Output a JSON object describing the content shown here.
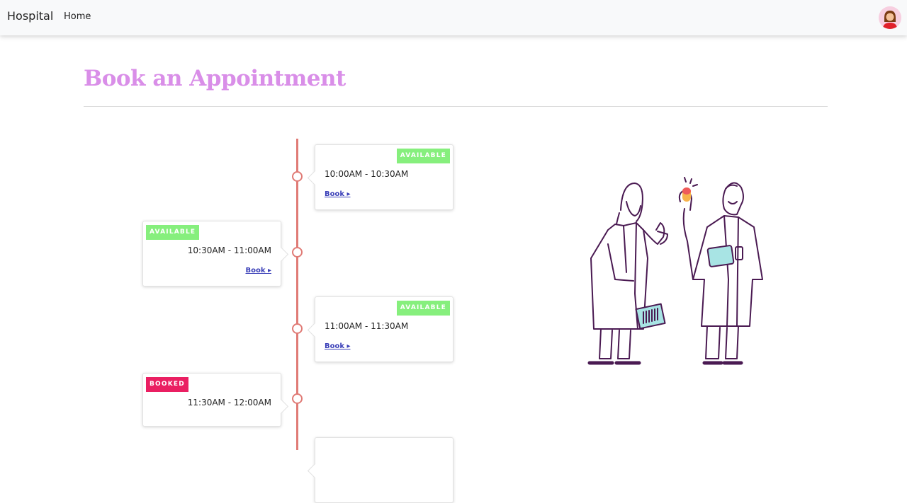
{
  "navbar": {
    "brand": "Hospital",
    "home_label": "Home",
    "avatar_icon": "user-avatar-icon"
  },
  "page": {
    "title": "Book an Appointment"
  },
  "colors": {
    "title": "#d98ee8",
    "timeline": "#e07b76",
    "available": "#86ef7d",
    "booked": "#ea1f62",
    "link": "#3a3fb8"
  },
  "slots": [
    {
      "status": "AVAILABLE",
      "time": "10:00AM - 10:30AM",
      "action": "Book ▸"
    },
    {
      "status": "AVAILABLE",
      "time": "10:30AM - 11:00AM",
      "action": "Book ▸"
    },
    {
      "status": "AVAILABLE",
      "time": "11:00AM - 11:30AM",
      "action": "Book ▸"
    },
    {
      "status": "BOOKED",
      "time": "11:30AM - 12:00AM",
      "action": ""
    }
  ],
  "illustration_icon": "doctors-illustration-icon"
}
